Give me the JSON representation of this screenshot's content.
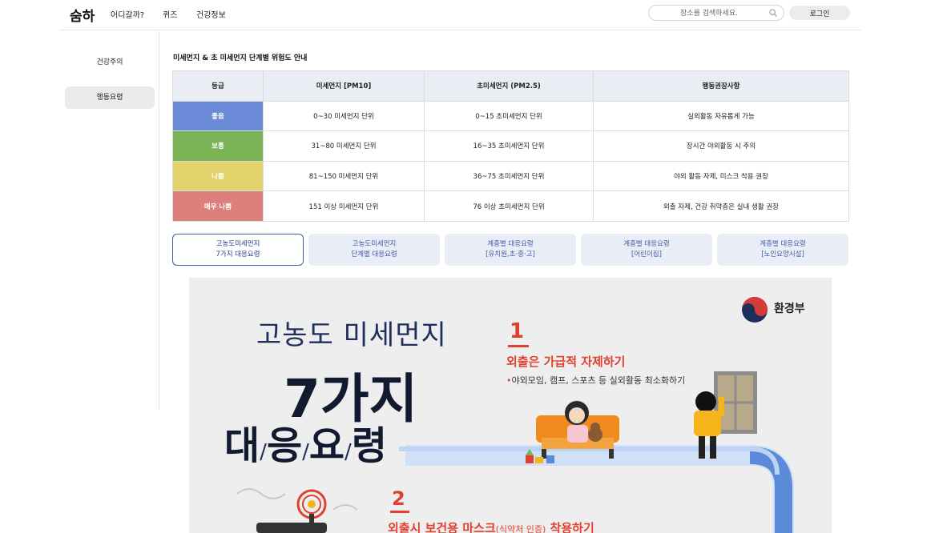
{
  "header": {
    "logo": "숨하",
    "nav": [
      "어디갈까?",
      "퀴즈",
      "건강정보"
    ],
    "search_placeholder": "장소를 검색하세요.",
    "login_label": "로그인"
  },
  "sidebar": {
    "items": [
      {
        "label": "건강주의",
        "active": false
      },
      {
        "label": "행동요령",
        "active": true
      }
    ]
  },
  "main": {
    "section_title": "미세먼지 & 초 미세먼지 단계별 위험도 안내",
    "table": {
      "headers": [
        "등급",
        "미세먼지 [PM10]",
        "초미세먼지 (PM2.5)",
        "행동권장사항"
      ],
      "rows": [
        {
          "grade": "좋음",
          "color": "#6a89d6",
          "pm10": "0~30 미세먼지 단위",
          "pm25": "0~15 초미세먼지 단위",
          "action": "실외활동 자유롭게 가능"
        },
        {
          "grade": "보통",
          "color": "#79b356",
          "pm10": "31~80 미세먼지 단위",
          "pm25": "16~35 초미세먼지 단위",
          "action": "장시간 야외활동 시 주의"
        },
        {
          "grade": "나쁨",
          "color": "#e2d36c",
          "pm10": "81~150 미세먼지 단위",
          "pm25": "36~75 초미세먼지 단위",
          "action": "야외 활동 자제, 미스크 착용 권장"
        },
        {
          "grade": "매우 나쁨",
          "color": "#dd7f7b",
          "pm10": "151 이상 미세먼지 단위",
          "pm25": "76 이상 초미세먼지 단위",
          "action": "외출 자제, 건강 취약층은 실내 생활 권장"
        }
      ]
    },
    "tabs": [
      {
        "line1": "고농도미세먼지",
        "line2": "7가지 대응요령",
        "active": true
      },
      {
        "line1": "고농도미세먼지",
        "line2": "단계별 대응요령",
        "active": false
      },
      {
        "line1": "계층별 대응요령",
        "line2": "[유치원,초·중·고]",
        "active": false
      },
      {
        "line1": "계층별 대응요령",
        "line2": "[어린이집]",
        "active": false
      },
      {
        "line1": "계층별 대응요령",
        "line2": "[노인요양시설]",
        "active": false
      }
    ]
  },
  "poster": {
    "title_small": "고농도 미세먼지",
    "title_big": "7가지",
    "title_words": [
      "대",
      "응",
      "요",
      "령"
    ],
    "ministry": "환경부",
    "step1": {
      "num": "1",
      "heading": "외출은 가급적 자제하기",
      "sub": "야외모임, 캠프, 스포츠 등 실외활동 최소화하기"
    },
    "step2": {
      "num": "2",
      "heading": "외출시 보건용 마스크",
      "heading_small": "(식약처 인증)",
      "heading_end": " 착용하기"
    },
    "accent_color": "#e0412f",
    "navy_color": "#1f2f5c"
  }
}
